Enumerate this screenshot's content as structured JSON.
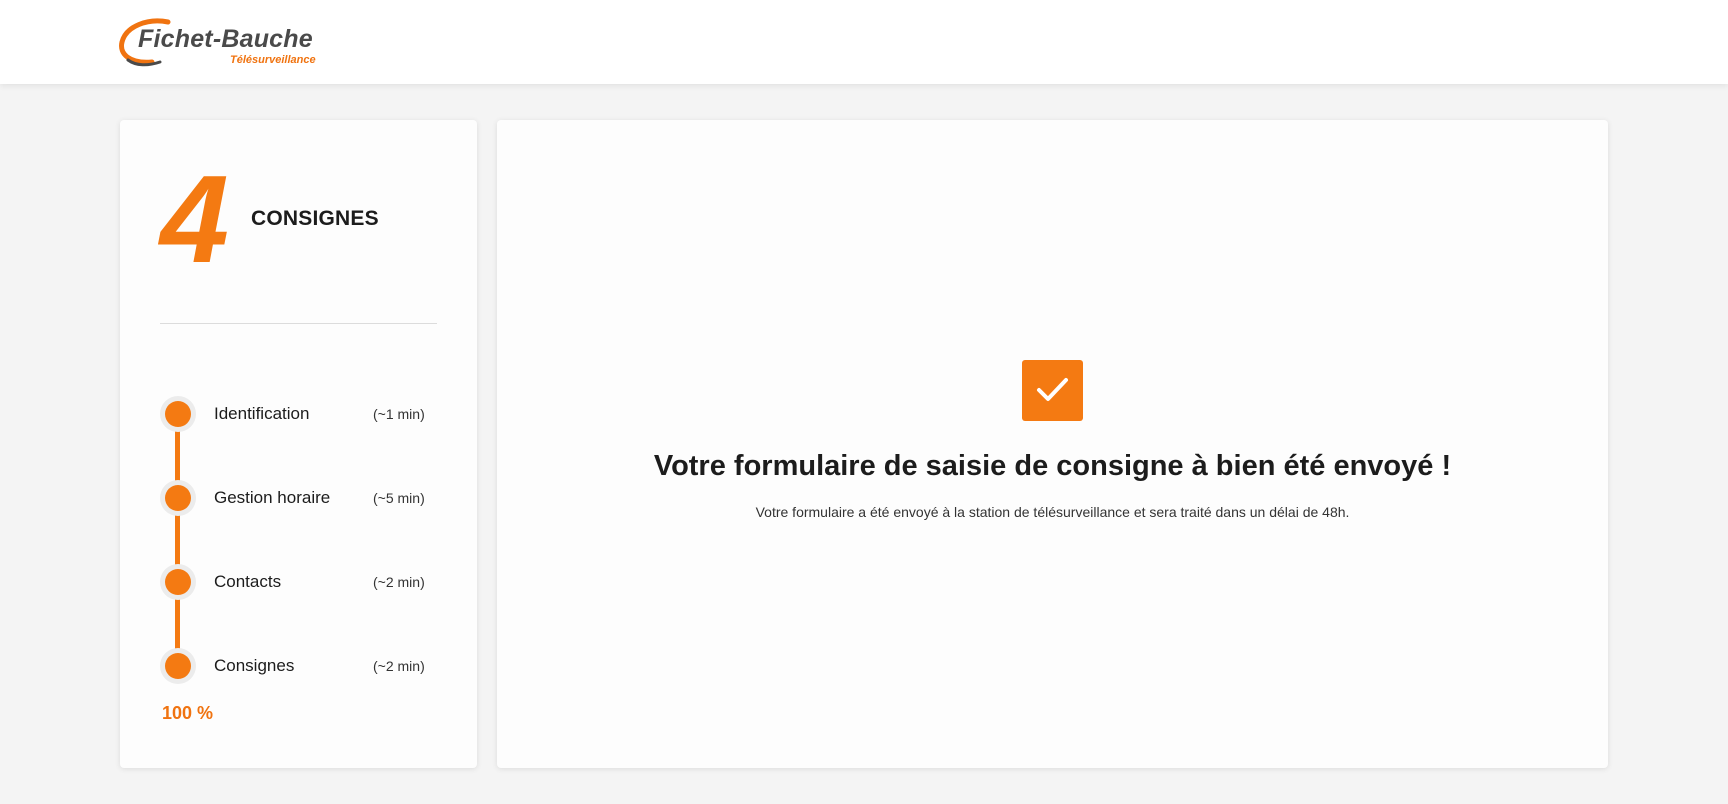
{
  "brand": {
    "name": "Fichet-Bauche",
    "subtitle": "Télésurveillance",
    "accent_color": "#f47a12"
  },
  "sidebar": {
    "step_number": "4",
    "step_title": "CONSIGNES",
    "steps": [
      {
        "label": "Identification",
        "duration": "(~1 min)"
      },
      {
        "label": "Gestion horaire",
        "duration": "(~5 min)"
      },
      {
        "label": "Contacts",
        "duration": "(~2 min)"
      },
      {
        "label": "Consignes",
        "duration": "(~2 min)"
      }
    ],
    "progress_text": "100 %",
    "progress_fraction": 1.0
  },
  "main": {
    "status_icon": "check-icon",
    "title": "Votre formulaire de saisie de consigne à bien été envoyé !",
    "message": "Votre formulaire a été envoyé à la station de télésurveillance et sera traité dans un délai de 48h."
  }
}
